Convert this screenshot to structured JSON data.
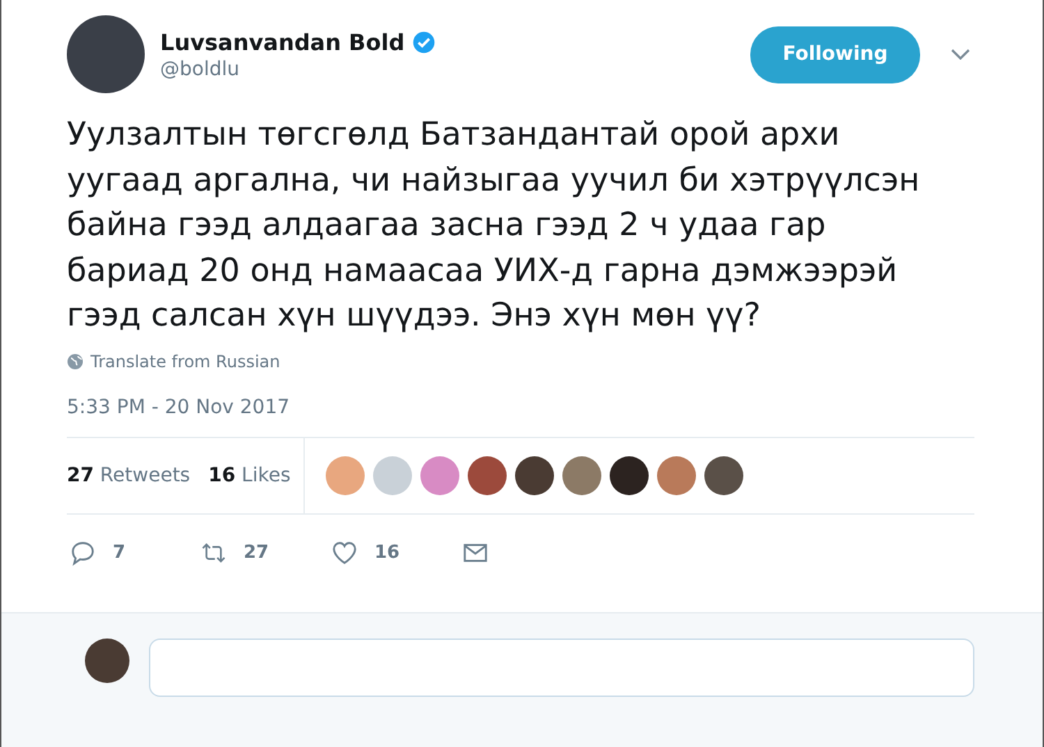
{
  "author": {
    "name": "Luvsanvandan Bold",
    "verified": true,
    "handle": "@boldlu"
  },
  "follow_button": {
    "label": "Following"
  },
  "tweet_text": "Уулзалтын төгсгөлд Батзандантай орой архи уугаад аргална, чи найзыгаа уучил би хэтрүүлсэн байна гээд алдаагаа засна гээд 2 ч удаа гар бариад 20 онд намаасаа УИХ-д гарна дэмжээрэй гээд салсан хүн шүүдээ. Энэ хүн мөн үү?",
  "translate_link": "Translate from Russian",
  "timestamp": "5:33 PM - 20 Nov 2017",
  "stats": [
    {
      "count": "27",
      "label": "Retweets"
    },
    {
      "count": "16",
      "label": "Likes"
    }
  ],
  "actions": [
    {
      "kind": "reply",
      "count": "7"
    },
    {
      "kind": "retweet",
      "count": "27"
    },
    {
      "kind": "like",
      "count": "16"
    },
    {
      "kind": "message"
    }
  ]
}
